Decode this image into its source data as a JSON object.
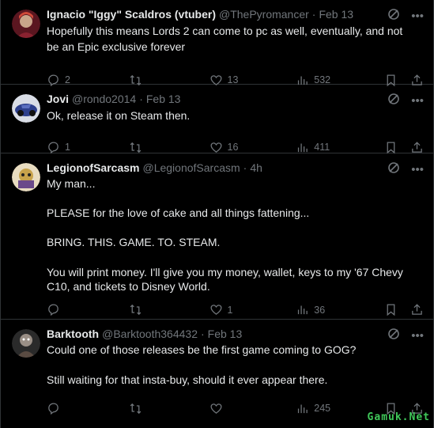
{
  "tweets": [
    {
      "name": "Ignacio \"Iggy\" Scaldros (vtuber)",
      "handle": "@ThePyromancer",
      "time": "Feb 13",
      "text": "Hopefully this means Lords 2 can come to pc as well, eventually, and not be an Epic exclusive forever",
      "replies": "2",
      "retweets": "",
      "likes": "13",
      "views": "532",
      "avatar_color": "#7a1f2b"
    },
    {
      "name": "Jovi",
      "handle": "@rondo2014",
      "time": "Feb 13",
      "text": "Ok, release it on Steam then.",
      "replies": "1",
      "retweets": "",
      "likes": "16",
      "views": "411",
      "avatar_color": "#4a5fa8"
    },
    {
      "name": "LegionofSarcasm",
      "handle": "@LegionofSarcasm",
      "time": "4h",
      "text": "My man...\n\nPLEASE for the love of cake and all things fattening...\n\nBRING. THIS. GAME. TO. STEAM.\n\nYou will print money. I'll give you my money, wallet, keys to my '67 Chevy C10, and tickets to Disney World.",
      "replies": "",
      "retweets": "",
      "likes": "1",
      "views": "36",
      "avatar_color": "#b89a3c"
    },
    {
      "name": "Barktooth",
      "handle": "@Barktooth364432",
      "time": "Feb 13",
      "text": "Could one of those releases be the first game coming to GOG?\n\nStill waiting for that insta-buy, should it ever appear there.",
      "replies": "",
      "retweets": "",
      "likes": "",
      "views": "245",
      "avatar_color": "#3a3a3a"
    }
  ],
  "watermark": "Gamuk.Net",
  "colors": {
    "background": "#000000",
    "text": "#e7e9ea",
    "muted": "#71767b",
    "border": "#2f3336",
    "watermark": "#40c85a"
  }
}
